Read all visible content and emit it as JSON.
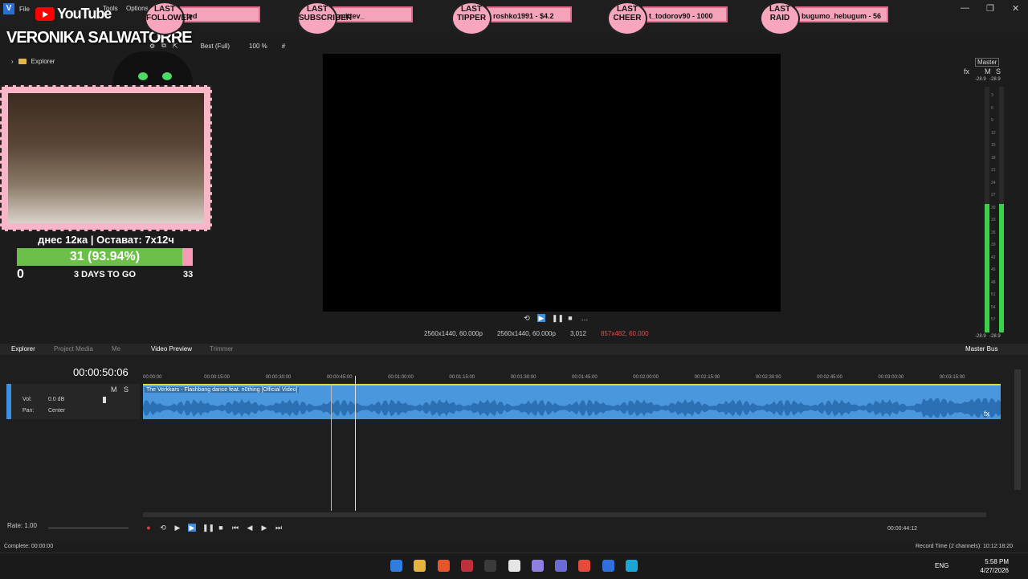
{
  "menu": {
    "app_icon": "V",
    "items": [
      "File",
      "Tools",
      "Options"
    ]
  },
  "window_controls": [
    "—",
    "❐",
    "✕"
  ],
  "stream_overlay": {
    "youtube_word": "YouTube",
    "channel": "VERONIKA SALWATORRE",
    "alerts": [
      {
        "badge": "LAST FOLLOWER",
        "value": "ted"
      },
      {
        "badge": "LAST SUBSCRIBER",
        "value": "mittev_"
      },
      {
        "badge": "LAST TIPPER",
        "value": "roshko1991 - $4.2"
      },
      {
        "badge": "LAST CHEER",
        "value": "t_todorov90 - 1000"
      },
      {
        "badge": "LAST RAID",
        "value": "bugumo_hebugum - 56"
      }
    ],
    "goal": {
      "header": "днес 12ка | Остават: 7х12ч",
      "progress_label": "31 (93.94%)",
      "progress_fraction": 0.9394,
      "min": "0",
      "days": "3 DAYS TO GO",
      "max": "33"
    }
  },
  "explorer": {
    "label": "Explorer"
  },
  "preview_toolbar": {
    "quality": "Best (Full)",
    "zoom": "100 %"
  },
  "preview_info": {
    "project": "2560x1440, 60.000p",
    "preview": "2560x1440, 60.000p",
    "frame": "3,012",
    "display": "857x482, 60.000"
  },
  "master": {
    "label": "Master",
    "m": "M",
    "s": "S",
    "fx": "fx",
    "level_left": "-28.9",
    "level_right": "-28.9",
    "bus_label": "Master Bus",
    "scale": [
      "3",
      "6",
      "9",
      "12",
      "15",
      "18",
      "21",
      "24",
      "27",
      "30",
      "33",
      "36",
      "39",
      "42",
      "45",
      "48",
      "51",
      "54",
      "57"
    ]
  },
  "tabs": {
    "explorer": "Explorer",
    "project_media": "Project Media",
    "media": "Me",
    "video_preview": "Video Preview",
    "trimmer": "Trimmer"
  },
  "timeline": {
    "timecode": "00:00:50:06",
    "track": {
      "m": "M",
      "s": "S",
      "vol_label": "Vol:",
      "vol_value": "0.0 dB",
      "pan_label": "Pan:",
      "pan_value": "Center"
    },
    "ruler": [
      "00:00:00",
      "00:00:15:00",
      "00:00:30:00",
      "00:00:45:00",
      "00:01:00:00",
      "00:01:15:00",
      "00:01:30:00",
      "00:01:45:00",
      "00:02:00:00",
      "00:02:15:00",
      "00:02:30:00",
      "00:02:45:00",
      "00:03:00:00",
      "00:03:15:00"
    ],
    "clip_title": "The Verkkars - Flashbang dance feat. n0thing [Official Video]",
    "clip_fx": "fx",
    "rate": "Rate: 1.00",
    "record_time_small": "00:00:44:12"
  },
  "status": {
    "left": "Complete: 00:00:00",
    "right": "Record Time (2 channels): 10:12:18:20"
  },
  "taskbar": {
    "lang": "ENG",
    "time": "5:58 PM",
    "date": "4/27/2026",
    "app_colors": [
      "#2f7de1",
      "#e6b43c",
      "#e8542b",
      "#c0303b",
      "#3b3b3b",
      "#e5e5e5",
      "#8f7fe0",
      "#6b6bd6",
      "#e54b3c",
      "#2f6fe0",
      "#1aa6d6"
    ]
  }
}
